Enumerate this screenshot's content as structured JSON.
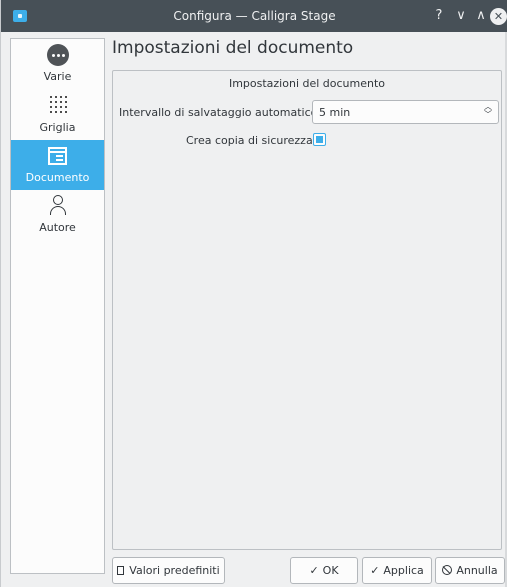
{
  "window": {
    "title": "Configura — Calligra Stage",
    "buttons": {
      "help": "?",
      "minimize": "∨",
      "maximize": "∧",
      "close": "✕"
    }
  },
  "sidebar": {
    "items": [
      {
        "label": "Varie",
        "icon": "more-icon",
        "active": false
      },
      {
        "label": "Griglia",
        "icon": "grid-icon",
        "active": false
      },
      {
        "label": "Documento",
        "icon": "document-icon",
        "active": true
      },
      {
        "label": "Autore",
        "icon": "user-icon",
        "active": false
      }
    ]
  },
  "main": {
    "page_title": "Impostazioni del documento",
    "group_title": "Impostazioni del documento",
    "autosave": {
      "label": "Intervallo di salvataggio automatico:",
      "value": "5 min"
    },
    "backup": {
      "label": "Crea copia di sicurezza:",
      "checked": true
    }
  },
  "footer": {
    "defaults_label": "Valori predefiniti",
    "ok_label": "OK",
    "apply_label": "Applica",
    "cancel_label": "Annulla"
  },
  "colors": {
    "accent": "#3daee9",
    "titlebar": "#475057",
    "window_bg": "#eff0f1"
  }
}
